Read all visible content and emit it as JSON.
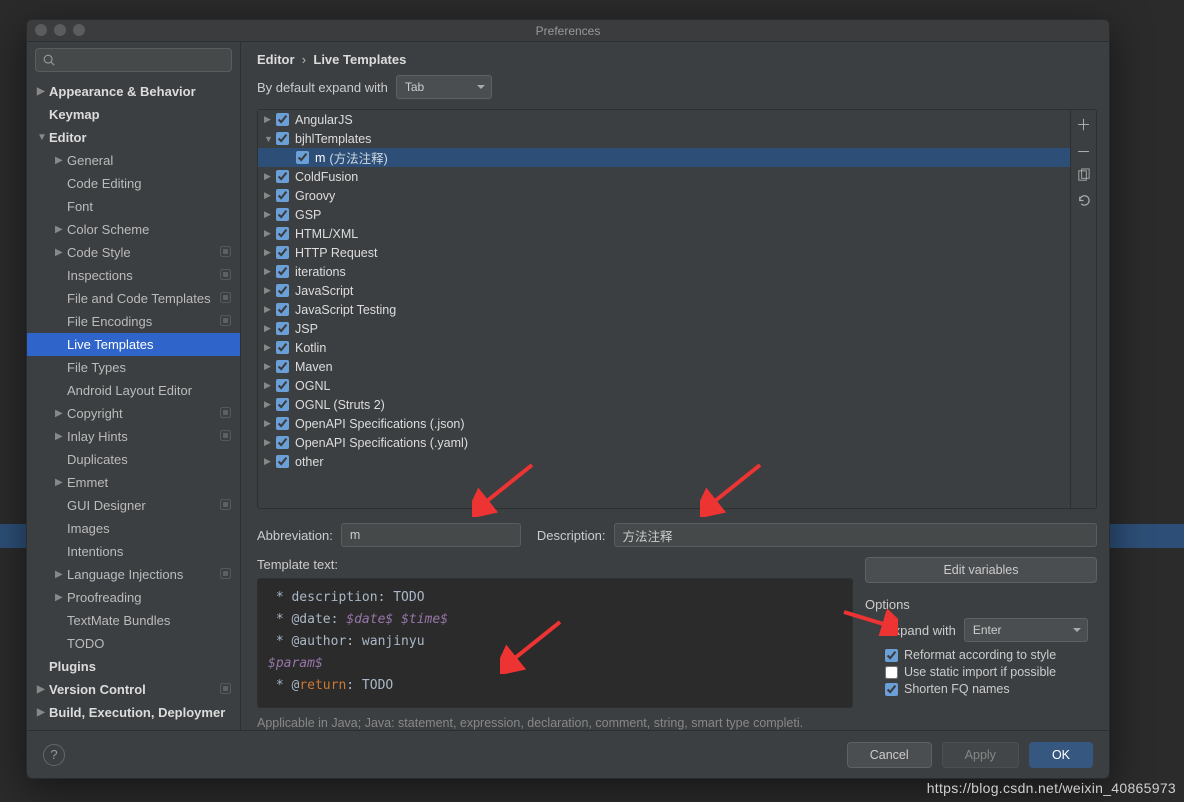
{
  "window": {
    "title": "Preferences"
  },
  "breadcrumb": {
    "cat": "Editor",
    "sep": "›",
    "page": "Live Templates"
  },
  "expand": {
    "label": "By default expand with",
    "value": "Tab"
  },
  "sidebar": {
    "items": [
      {
        "label": "Appearance & Behavior",
        "bold": true,
        "depth": 0,
        "arrow": "▶"
      },
      {
        "label": "Keymap",
        "bold": true,
        "depth": 0,
        "arrow": ""
      },
      {
        "label": "Editor",
        "bold": true,
        "depth": 0,
        "arrow": "▼"
      },
      {
        "label": "General",
        "depth": 1,
        "arrow": "▶"
      },
      {
        "label": "Code Editing",
        "depth": 1,
        "arrow": ""
      },
      {
        "label": "Font",
        "depth": 1,
        "arrow": ""
      },
      {
        "label": "Color Scheme",
        "depth": 1,
        "arrow": "▶"
      },
      {
        "label": "Code Style",
        "depth": 1,
        "arrow": "▶",
        "badge": true
      },
      {
        "label": "Inspections",
        "depth": 1,
        "arrow": "",
        "badge": true
      },
      {
        "label": "File and Code Templates",
        "depth": 1,
        "arrow": "",
        "badge": true
      },
      {
        "label": "File Encodings",
        "depth": 1,
        "arrow": "",
        "badge": true
      },
      {
        "label": "Live Templates",
        "depth": 1,
        "arrow": "",
        "sel": true
      },
      {
        "label": "File Types",
        "depth": 1,
        "arrow": ""
      },
      {
        "label": "Android Layout Editor",
        "depth": 1,
        "arrow": ""
      },
      {
        "label": "Copyright",
        "depth": 1,
        "arrow": "▶",
        "badge": true
      },
      {
        "label": "Inlay Hints",
        "depth": 1,
        "arrow": "▶",
        "badge": true
      },
      {
        "label": "Duplicates",
        "depth": 1,
        "arrow": ""
      },
      {
        "label": "Emmet",
        "depth": 1,
        "arrow": "▶"
      },
      {
        "label": "GUI Designer",
        "depth": 1,
        "arrow": "",
        "badge": true
      },
      {
        "label": "Images",
        "depth": 1,
        "arrow": ""
      },
      {
        "label": "Intentions",
        "depth": 1,
        "arrow": ""
      },
      {
        "label": "Language Injections",
        "depth": 1,
        "arrow": "▶",
        "badge": true
      },
      {
        "label": "Proofreading",
        "depth": 1,
        "arrow": "▶"
      },
      {
        "label": "TextMate Bundles",
        "depth": 1,
        "arrow": ""
      },
      {
        "label": "TODO",
        "depth": 1,
        "arrow": ""
      },
      {
        "label": "Plugins",
        "bold": true,
        "depth": 0,
        "arrow": ""
      },
      {
        "label": "Version Control",
        "bold": true,
        "depth": 0,
        "arrow": "▶",
        "badge": true
      },
      {
        "label": "Build, Execution, Deploymer",
        "bold": true,
        "depth": 0,
        "arrow": "▶"
      }
    ]
  },
  "groups": [
    {
      "label": "AngularJS",
      "arrow": "▶"
    },
    {
      "label": "bjhlTemplates",
      "arrow": "▼",
      "children": [
        {
          "abbr": "m",
          "desc": "(方法注释)",
          "sel": true
        }
      ]
    },
    {
      "label": "ColdFusion",
      "arrow": "▶"
    },
    {
      "label": "Groovy",
      "arrow": "▶"
    },
    {
      "label": "GSP",
      "arrow": "▶"
    },
    {
      "label": "HTML/XML",
      "arrow": "▶"
    },
    {
      "label": "HTTP Request",
      "arrow": "▶"
    },
    {
      "label": "iterations",
      "arrow": "▶"
    },
    {
      "label": "JavaScript",
      "arrow": "▶"
    },
    {
      "label": "JavaScript Testing",
      "arrow": "▶"
    },
    {
      "label": "JSP",
      "arrow": "▶"
    },
    {
      "label": "Kotlin",
      "arrow": "▶"
    },
    {
      "label": "Maven",
      "arrow": "▶"
    },
    {
      "label": "OGNL",
      "arrow": "▶"
    },
    {
      "label": "OGNL (Struts 2)",
      "arrow": "▶"
    },
    {
      "label": "OpenAPI Specifications (.json)",
      "arrow": "▶"
    },
    {
      "label": "OpenAPI Specifications (.yaml)",
      "arrow": "▶"
    },
    {
      "label": "other",
      "arrow": "▶"
    }
  ],
  "form": {
    "abbr_label": "Abbreviation:",
    "abbr_value": "m",
    "desc_label": "Description:",
    "desc_value": "方法注释",
    "tmpl_label": "Template text:",
    "edit_vars": "Edit variables",
    "options_hd": "Options",
    "expand_with": "Expand with",
    "expand_value": "Enter",
    "opt1": "Reformat according to style",
    "opt2": "Use static import if possible",
    "opt3": "Shorten FQ names",
    "code_l1": " * description: TODO",
    "code_l2a": " * @date: ",
    "code_l2b": "$date$ $time$",
    "code_l3": " * @author: wanjinyu",
    "code_l4": "$param$",
    "code_l5a": " * @",
    "code_l5b": "return",
    "code_l5c": ": TODO",
    "applicable": "Applicable in Java; Java: statement, expression, declaration, comment, string, smart type completi."
  },
  "footer": {
    "cancel": "Cancel",
    "apply": "Apply",
    "ok": "OK"
  },
  "watermark": "https://blog.csdn.net/weixin_40865973"
}
